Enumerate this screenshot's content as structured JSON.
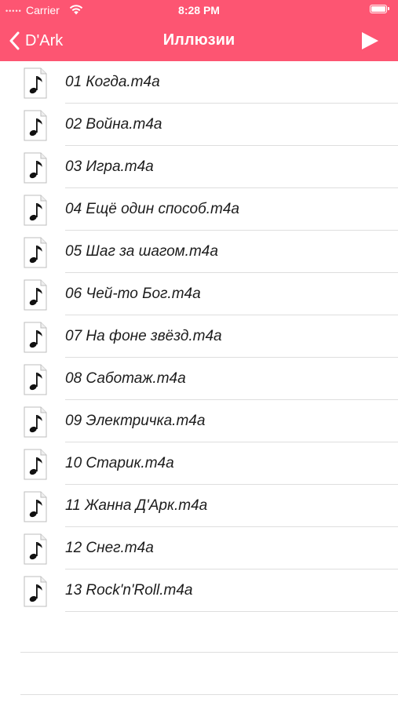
{
  "status_bar": {
    "carrier": "Carrier",
    "time": "8:28 PM",
    "signal_glyph": "•••••"
  },
  "navbar": {
    "back_label": "D'Ark",
    "title": "Иллюзии",
    "play_icon": "play-icon",
    "back_icon": "chevron-left-icon"
  },
  "colors": {
    "accent": "#fd5572",
    "separator": "#dedede"
  },
  "tracks": [
    {
      "title": "01 Когда.m4a"
    },
    {
      "title": "02 Война.m4a"
    },
    {
      "title": "03 Игра.m4a"
    },
    {
      "title": "04 Ещё один способ.m4a"
    },
    {
      "title": "05 Шаг за шагом.m4a"
    },
    {
      "title": "06 Чей-то Бог.m4a"
    },
    {
      "title": "07 На фоне звёзд.m4a"
    },
    {
      "title": "08 Саботаж.m4a"
    },
    {
      "title": "09 Электричка.m4a"
    },
    {
      "title": "10 Старик.m4a"
    },
    {
      "title": "11 Жанна Д'Арк.m4a"
    },
    {
      "title": "12 Снег.m4a"
    },
    {
      "title": "13 Rock'n'Roll.m4a"
    }
  ]
}
